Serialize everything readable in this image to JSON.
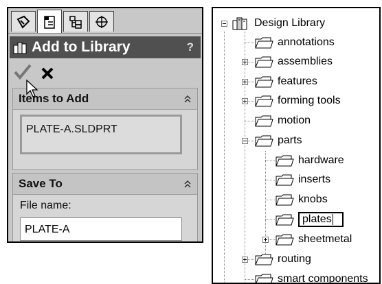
{
  "property_manager": {
    "title": "Add to Library",
    "help": "?",
    "tabs": [
      "feature-manager",
      "property-manager",
      "configuration-manager",
      "dimxpert-manager"
    ],
    "items_group": {
      "label": "Items to Add",
      "items": [
        "PLATE-A.SLDPRT"
      ]
    },
    "save_group": {
      "label": "Save To",
      "file_name_label": "File name:",
      "file_name_value": "PLATE-A"
    }
  },
  "design_library": {
    "root": "Design Library",
    "items": [
      {
        "label": "annotations"
      },
      {
        "label": "assemblies"
      },
      {
        "label": "features"
      },
      {
        "label": "forming tools"
      },
      {
        "label": "motion"
      },
      {
        "label": "parts"
      },
      {
        "label": "hardware"
      },
      {
        "label": "inserts"
      },
      {
        "label": "knobs"
      },
      {
        "label": "plates"
      },
      {
        "label": "sheetmetal"
      },
      {
        "label": "routing"
      },
      {
        "label": "smart components"
      }
    ]
  }
}
